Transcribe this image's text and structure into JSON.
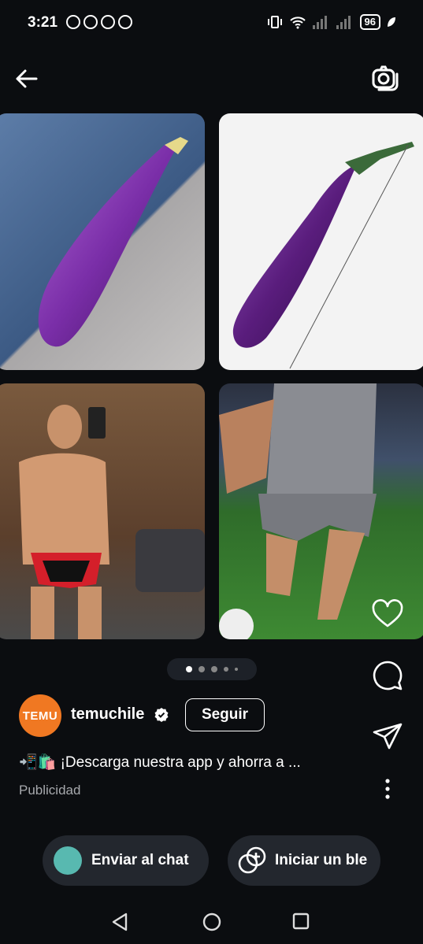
{
  "status_bar": {
    "time": "3:21",
    "battery": "96"
  },
  "post": {
    "username": "temuchile",
    "avatar_text": "TEMU",
    "follow_label": "Seguir",
    "caption": "📲🛍️ ¡Descarga nuestra app y ahorra a ...",
    "sponsored_label": "Publicidad",
    "carousel_dots": 5,
    "active_dot": 0
  },
  "actions": {
    "send_chat_label": "Enviar al chat",
    "blend_label": "Iniciar un ble"
  },
  "colors": {
    "background": "#0b0d10",
    "pill": "#23272e",
    "temu_orange": "#f07822"
  }
}
